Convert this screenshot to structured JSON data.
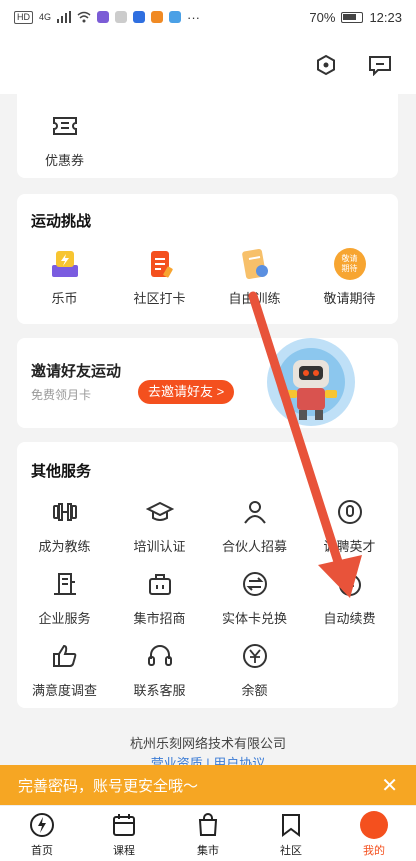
{
  "status_bar": {
    "network": "4G",
    "battery_text": "70%",
    "time": "12:23",
    "more": "···"
  },
  "coupon": {
    "label": "优惠券"
  },
  "challenge": {
    "title": "运动挑战",
    "items": [
      {
        "label": "乐币",
        "icon": "coin-box-icon"
      },
      {
        "label": "社区打卡",
        "icon": "checkin-note-icon"
      },
      {
        "label": "自由训练",
        "icon": "training-card-icon"
      },
      {
        "label": "敬请期待",
        "icon": "coming-soon-icon"
      }
    ],
    "coming_soon_badge": "敬请\n期待"
  },
  "invite": {
    "title": "邀请好友运动",
    "subtitle": "免费领月卡",
    "button_label": "去邀请好友 >"
  },
  "other_services": {
    "title": "其他服务",
    "items": [
      {
        "label": "成为教练",
        "icon": "dumbbell-icon"
      },
      {
        "label": "培训认证",
        "icon": "graduation-cap-icon"
      },
      {
        "label": "合伙人招募",
        "icon": "person-icon"
      },
      {
        "label": "诚聘英才",
        "icon": "medal-icon"
      },
      {
        "label": "企业服务",
        "icon": "building-icon"
      },
      {
        "label": "集市招商",
        "icon": "briefcase-icon"
      },
      {
        "label": "实体卡兑换",
        "icon": "exchange-icon"
      },
      {
        "label": "自动续费",
        "icon": "renew-yen-icon"
      },
      {
        "label": "满意度调查",
        "icon": "thumbs-up-icon"
      },
      {
        "label": "联系客服",
        "icon": "headset-icon"
      },
      {
        "label": "余额",
        "icon": "yen-circle-icon"
      }
    ]
  },
  "footer": {
    "company": "杭州乐刻网络技术有限公司",
    "links": "营业资质 | 用户协议"
  },
  "banner": {
    "text": "完善密码，账号更安全哦～",
    "close": "✕"
  },
  "tabbar": {
    "items": [
      {
        "label": "首页",
        "icon": "lightning-icon"
      },
      {
        "label": "课程",
        "icon": "calendar-icon"
      },
      {
        "label": "集市",
        "icon": "shopping-bag-icon"
      },
      {
        "label": "社区",
        "icon": "bookmark-icon"
      },
      {
        "label": "我的",
        "icon": "avatar-icon"
      }
    ],
    "active_index": 4
  },
  "colors": {
    "accent": "#f4501e",
    "banner": "#f6a623",
    "arrow": "#e8533a",
    "link": "#3a7bd5"
  }
}
